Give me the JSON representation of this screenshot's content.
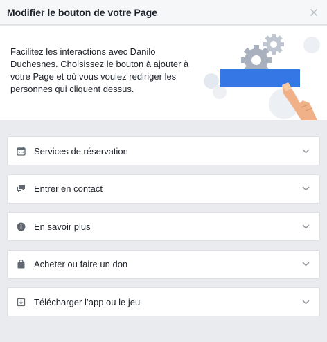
{
  "dialog": {
    "title": "Modifier le bouton de votre Page",
    "close_glyph": "×",
    "intro": "Facilitez les interactions avec Danilo Duchesnes. Choisissez le bouton à ajouter à votre Page et où vous voulez rediriger les personnes qui cliquent dessus."
  },
  "options": [
    {
      "label": "Services de réservation",
      "icon": "calendar-icon"
    },
    {
      "label": "Entrer en contact",
      "icon": "chat-bubbles-icon"
    },
    {
      "label": "En savoir plus",
      "icon": "info-icon"
    },
    {
      "label": "Acheter ou faire un don",
      "icon": "shopping-bag-icon"
    },
    {
      "label": "Télécharger l’app ou le jeu",
      "icon": "download-icon"
    }
  ],
  "colors": {
    "accent_blue": "#3578e5",
    "icon_gray": "#606770",
    "background": "#e9ebee"
  }
}
